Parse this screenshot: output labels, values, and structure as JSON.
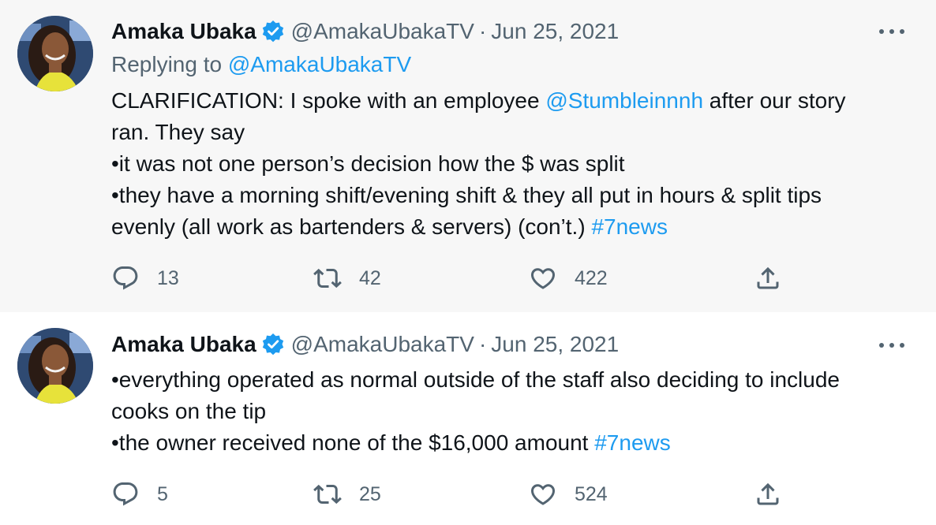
{
  "tweets": [
    {
      "author_name": "Amaka Ubaka",
      "handle": "@AmakaUbakaTV",
      "separator": "·",
      "date": "Jun 25, 2021",
      "replying_prefix": "Replying to ",
      "replying_to": "@AmakaUbakaTV",
      "body": {
        "l1_a": "CLARIFICATION: I spoke with an employee ",
        "l1_link": "@Stumbleinnnh",
        "l1_b": " after our story",
        "l2": "ran. They say",
        "l3": "•it was not one person’s decision how the $ was split",
        "l4": "•they have a morning shift/evening shift & they all put in hours & split tips",
        "l5_a": "evenly (all work as bartenders & servers) (con’t.) ",
        "l5_tag": "#7news"
      },
      "replies": "13",
      "retweets": "42",
      "likes": "422"
    },
    {
      "author_name": "Amaka Ubaka",
      "handle": "@AmakaUbakaTV",
      "separator": "·",
      "date": "Jun 25, 2021",
      "body": {
        "l1": "•everything operated as normal outside of the staff also deciding to include",
        "l2": "cooks on the tip",
        "l3_a": "•the owner received none of the $16,000 amount ",
        "l3_tag": "#7news"
      },
      "replies": "5",
      "retweets": "25",
      "likes": "524"
    }
  ],
  "icons": {
    "verified": "verified-badge-icon",
    "reply": "reply-icon",
    "retweet": "retweet-icon",
    "like": "like-icon",
    "share": "share-icon",
    "more": "more-icon"
  },
  "colors": {
    "link": "#1d9bf0",
    "secondary_text": "#536471",
    "primary_text": "#0f1419",
    "thread_background": "#f7f7f7"
  }
}
